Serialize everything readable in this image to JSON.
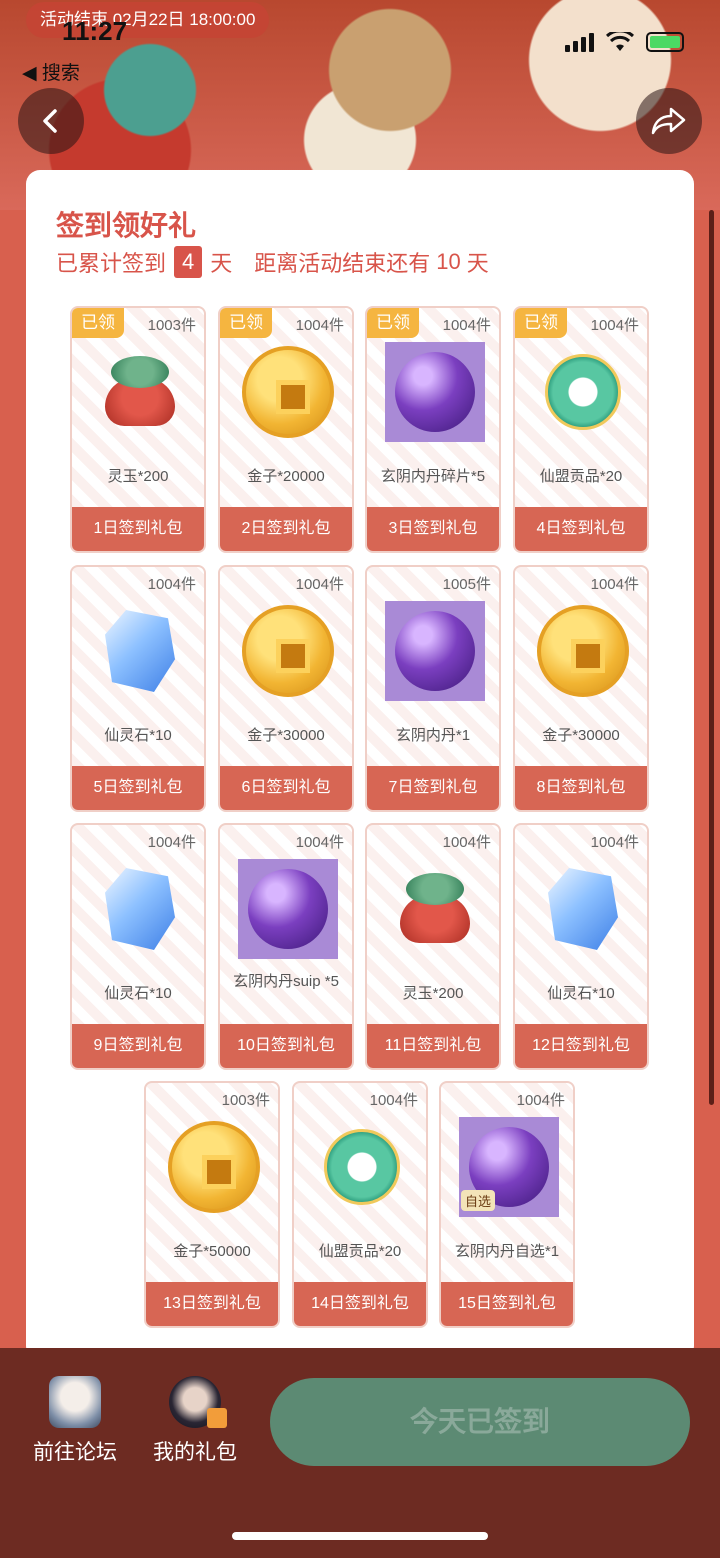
{
  "status_bar": {
    "time": "11:27",
    "back_label": "◀ 搜索"
  },
  "banner": {
    "end_time": "活动结束 02月22日 18:00:00"
  },
  "header": {
    "title": "签到领好礼",
    "sub_prefix": "已累计签到",
    "days": "4",
    "day_unit": "天",
    "remaining_prefix": "距离活动结束还有",
    "remaining_days": "10",
    "remaining_unit": "天"
  },
  "claimed_label": "已领",
  "gifts": [
    {
      "stock": "1003件",
      "name": "灵玉*200",
      "label": "1日签到礼包",
      "icon": "bag-icon",
      "claimed": true
    },
    {
      "stock": "1004件",
      "name": "金子*20000",
      "label": "2日签到礼包",
      "icon": "coin-icon",
      "claimed": true
    },
    {
      "stock": "1004件",
      "name": "玄阴内丹碎片*5",
      "label": "3日签到礼包",
      "icon": "orb-icon",
      "claimed": true
    },
    {
      "stock": "1004件",
      "name": "仙盟贡品*20",
      "label": "4日签到礼包",
      "icon": "jade-icon",
      "claimed": true
    },
    {
      "stock": "1004件",
      "name": "仙灵石*10",
      "label": "5日签到礼包",
      "icon": "crystal-icon",
      "claimed": false
    },
    {
      "stock": "1004件",
      "name": "金子*30000",
      "label": "6日签到礼包",
      "icon": "coin-icon",
      "claimed": false
    },
    {
      "stock": "1005件",
      "name": "玄阴内丹*1",
      "label": "7日签到礼包",
      "icon": "orb-icon",
      "claimed": false
    },
    {
      "stock": "1004件",
      "name": "金子*30000",
      "label": "8日签到礼包",
      "icon": "coin-icon",
      "claimed": false
    },
    {
      "stock": "1004件",
      "name": "仙灵石*10",
      "label": "9日签到礼包",
      "icon": "crystal-icon",
      "claimed": false
    },
    {
      "stock": "1004件",
      "name": "玄阴内丹suip *5",
      "label": "10日签到礼包",
      "icon": "orb-icon",
      "claimed": false
    },
    {
      "stock": "1004件",
      "name": "灵玉*200",
      "label": "11日签到礼包",
      "icon": "bag-icon",
      "claimed": false
    },
    {
      "stock": "1004件",
      "name": "仙灵石*10",
      "label": "12日签到礼包",
      "icon": "crystal-icon",
      "claimed": false
    },
    {
      "stock": "1003件",
      "name": "金子*50000",
      "label": "13日签到礼包",
      "icon": "coin-icon",
      "claimed": false
    },
    {
      "stock": "1004件",
      "name": "仙盟贡品*20",
      "label": "14日签到礼包",
      "icon": "jade-icon",
      "claimed": false
    },
    {
      "stock": "1004件",
      "name": "玄阴内丹自选*1",
      "label": "15日签到礼包",
      "icon": "orb-select-icon",
      "claimed": false,
      "tag": "自选"
    }
  ],
  "bottom_bar": {
    "forum_label": "前往论坛",
    "my_gifts_label": "我的礼包",
    "signed_label": "今天已签到"
  },
  "colors": {
    "accent": "#d8544a",
    "claimed_badge": "#f5b540",
    "signed_button": "#5c8a73",
    "bottom_bg": "#6d2b22"
  }
}
